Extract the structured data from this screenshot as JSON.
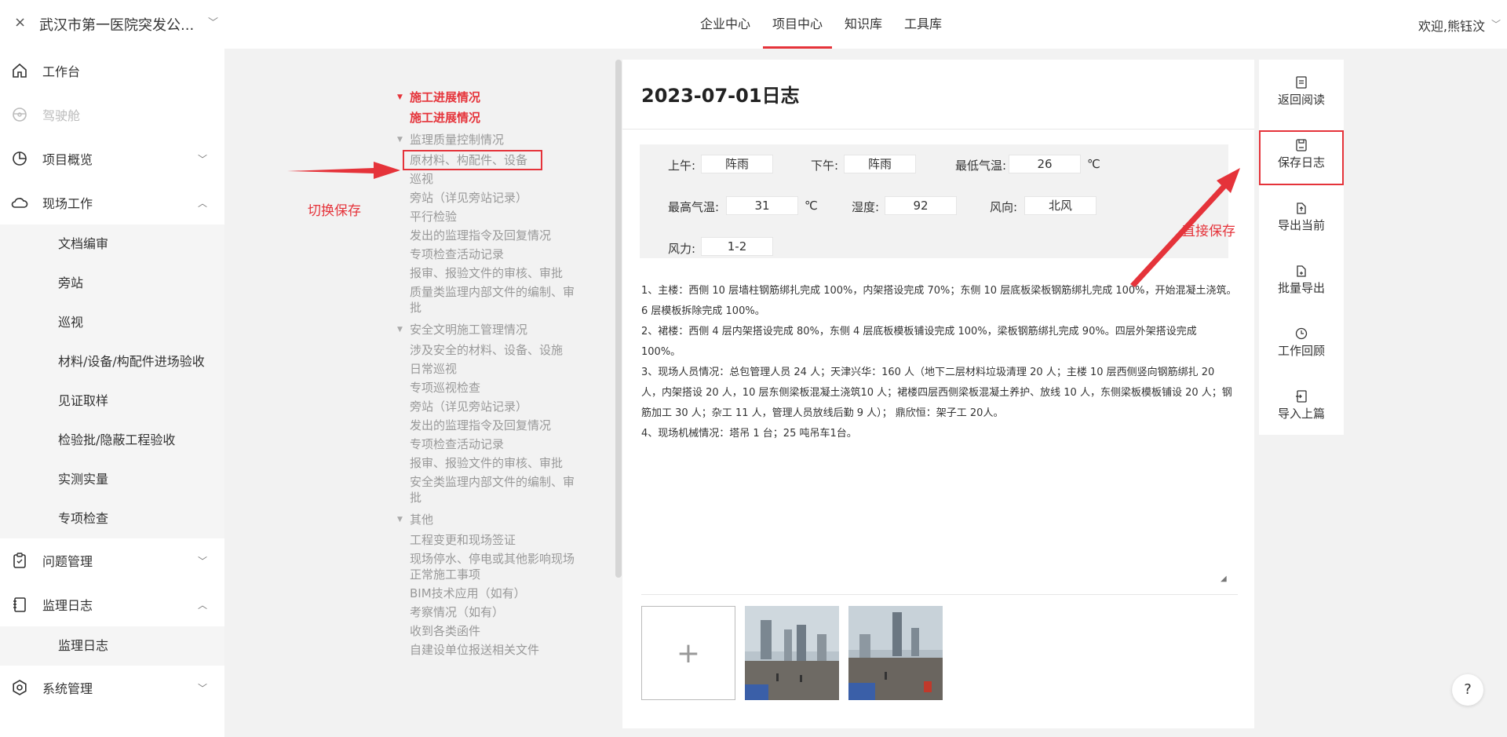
{
  "header": {
    "close_glyph": "×",
    "project_name": "武汉市第一医院突发公...",
    "nav_tabs": [
      {
        "label": "企业中心"
      },
      {
        "label": "项目中心"
      },
      {
        "label": "知识库"
      },
      {
        "label": "工具库"
      }
    ],
    "active_tab": "项目中心",
    "welcome": "欢迎,熊钰汶"
  },
  "sidebar": {
    "items": [
      {
        "label": "工作台"
      },
      {
        "label": "驾驶舱"
      },
      {
        "label": "项目概览"
      },
      {
        "label": "现场工作"
      },
      {
        "label": "问题管理"
      },
      {
        "label": "监理日志"
      },
      {
        "label": "系统管理"
      }
    ],
    "field_work_children": [
      "文档编审",
      "旁站",
      "巡视",
      "材料/设备/构配件进场验收",
      "见证取样",
      "检验批/隐蔽工程验收",
      "实测实量",
      "专项检查"
    ],
    "log_children": [
      "监理日志"
    ]
  },
  "tree": {
    "sections": [
      {
        "title": "施工进展情况",
        "items": [
          "施工进展情况"
        ]
      },
      {
        "title": "监理质量控制情况",
        "items": [
          "原材料、构配件、设备",
          "巡视",
          "旁站（详见旁站记录）",
          "平行检验",
          "发出的监理指令及回复情况",
          "专项检查活动记录",
          "报审、报验文件的审核、审批",
          "质量类监理内部文件的编制、审批"
        ]
      },
      {
        "title": "安全文明施工管理情况",
        "items": [
          "涉及安全的材料、设备、设施",
          "日常巡视",
          "专项巡视检查",
          "旁站（详见旁站记录）",
          "发出的监理指令及回复情况",
          "专项检查活动记录",
          "报审、报验文件的审核、审批",
          "安全类监理内部文件的编制、审批"
        ]
      },
      {
        "title": "其他",
        "items": [
          "工程变更和现场签证",
          "现场停水、停电或其他影响现场正常施工事项",
          "BIM技术应用（如有）",
          "考察情况（如有）",
          "收到各类函件",
          "自建设单位报送相关文件"
        ]
      }
    ]
  },
  "diary": {
    "title": "2023-07-01日志",
    "weather": {
      "am_label": "上午:",
      "am_value": "阵雨",
      "pm_label": "下午:",
      "pm_value": "阵雨",
      "min_label": "最低气温:",
      "min_value": "26",
      "max_label": "最高气温:",
      "max_value": "31",
      "temp_unit": "℃",
      "humidity_label": "湿度:",
      "humidity_value": "92",
      "wind_dir_label": "风向:",
      "wind_dir_value": "北风",
      "wind_force_label": "风力:",
      "wind_force_value": "1-2"
    },
    "text_lines": [
      "1、主楼：西侧 10 层墙柱钢筋绑扎完成 100%，内架搭设完成 70%；东侧 10 层底板梁板钢筋绑扎完成 100%，开始混凝土浇筑。6 层模板拆除完成 100%。",
      "2、裙楼：西侧 4 层内架搭设完成 80%，东侧 4 层底板模板铺设完成 100%，梁板钢筋绑扎完成 90%。四层外架搭设完成 100%。",
      "3、现场人员情况：总包管理人员 24 人；天津兴华：160 人（地下二层材料垃圾清理 20 人；主楼 10 层西侧竖向钢筋绑扎 20 人，内架搭设 20 人，10 层东侧梁板混凝土浇筑10 人；裙楼四层西侧梁板混凝土养护、放线 10 人，东侧梁板模板铺设 20 人；钢筋加工 30 人；杂工 11 人，管理人员放线后勤 9 人）； 鼎欣恒：架子工 20人。",
      "4、现场机械情况：塔吊 1 台；25 吨吊车1台。"
    ],
    "upload_glyph": "+"
  },
  "actions": [
    {
      "label": "返回阅读",
      "icon": "doc-icon"
    },
    {
      "label": "保存日志",
      "icon": "save-icon"
    },
    {
      "label": "导出当前",
      "icon": "export-icon"
    },
    {
      "label": "批量导出",
      "icon": "batch-export-icon"
    },
    {
      "label": "工作回顾",
      "icon": "history-icon"
    },
    {
      "label": "导入上篇",
      "icon": "import-icon"
    }
  ],
  "annotations": {
    "switch_save": "切换保存",
    "direct_save": "直接保存"
  },
  "help_glyph": "?",
  "colors": {
    "accent": "#e5333a"
  }
}
